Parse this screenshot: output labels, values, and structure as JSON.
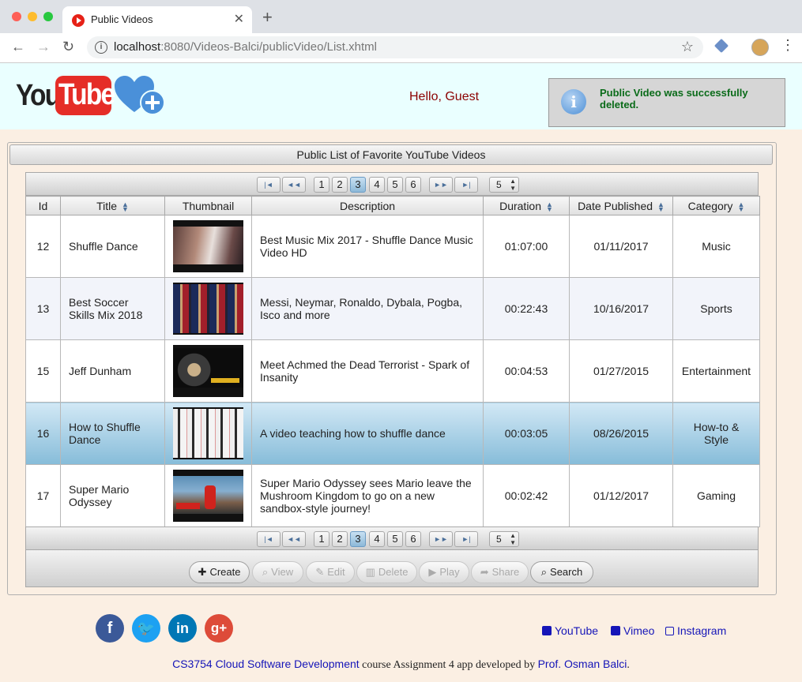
{
  "browser": {
    "tab_title": "Public Videos",
    "url_host": "localhost",
    "url_rest": ":8080/Videos-Balci/publicVideo/List.xhtml"
  },
  "header": {
    "logo_you": "You",
    "logo_tube": "Tube",
    "greeting": "Hello, Guest",
    "message": "Public Video was successfully deleted.",
    "message_icon": "i"
  },
  "panel": {
    "title": "Public List of Favorite YouTube Videos"
  },
  "paginator": {
    "first": "|◄",
    "prev": "◄◄",
    "next": "►►",
    "last": "►|",
    "pages": [
      "1",
      "2",
      "3",
      "4",
      "5",
      "6"
    ],
    "current_page": "3",
    "rows_per_page": "5"
  },
  "table": {
    "columns": [
      "Id",
      "Title",
      "Thumbnail",
      "Description",
      "Duration",
      "Date Published",
      "Category"
    ],
    "rows": [
      {
        "id": "12",
        "title": "Shuffle Dance",
        "description": "Best Music Mix 2017 - Shuffle Dance Music Video HD",
        "duration": "01:07:00",
        "date": "01/11/2017",
        "category": "Music"
      },
      {
        "id": "13",
        "title": "Best Soccer Skills Mix 2018",
        "description": "Messi, Neymar, Ronaldo, Dybala, Pogba, Isco and more",
        "duration": "00:22:43",
        "date": "10/16/2017",
        "category": "Sports"
      },
      {
        "id": "15",
        "title": "Jeff Dunham",
        "description": "Meet Achmed the Dead Terrorist - Spark of Insanity",
        "duration": "00:04:53",
        "date": "01/27/2015",
        "category": "Entertainment"
      },
      {
        "id": "16",
        "title": "How to Shuffle Dance",
        "description": "A video teaching how to shuffle dance",
        "duration": "00:03:05",
        "date": "08/26/2015",
        "category": "How-to & Style"
      },
      {
        "id": "17",
        "title": "Super Mario Odyssey",
        "description": "Super Mario Odyssey sees Mario leave the Mushroom Kingdom to go on a new sandbox-style journey!",
        "duration": "00:02:42",
        "date": "01/12/2017",
        "category": "Gaming"
      }
    ]
  },
  "actions": {
    "create": "Create",
    "view": "View",
    "edit": "Edit",
    "delete": "Delete",
    "play": "Play",
    "share": "Share",
    "search": "Search"
  },
  "footer": {
    "youtube": "YouTube",
    "vimeo": "Vimeo",
    "instagram": "Instagram",
    "course_link": "CS3754 Cloud Software Development",
    "credit_text": " course Assignment 4 app developed by ",
    "author_link": "Prof. Osman Balci",
    "credit_end": "."
  },
  "colors": {
    "facebook": "#3b5998",
    "twitter": "#1da1f2",
    "linkedin": "#0077b5",
    "googleplus": "#dd4b39",
    "link": "#1515b8"
  }
}
